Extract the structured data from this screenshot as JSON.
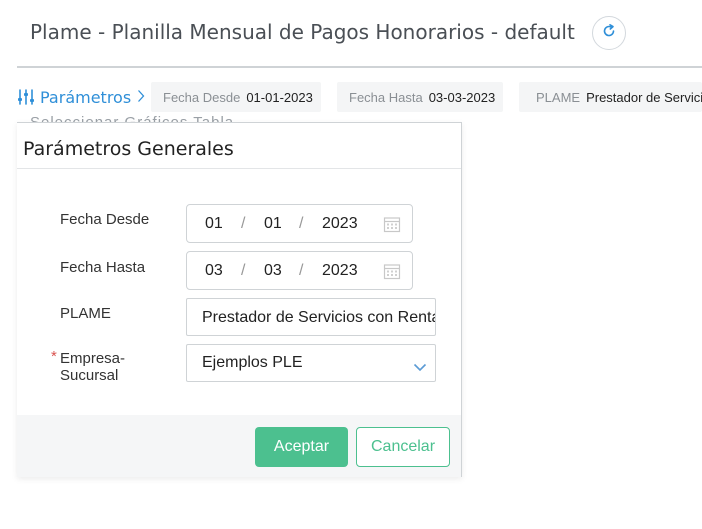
{
  "header": {
    "title": "Plame - Planilla Mensual de Pagos Honorarios - default",
    "refresh_icon": "refresh-icon"
  },
  "filter_bar": {
    "params_label": "Parámetros",
    "chips": [
      {
        "label": "Fecha Desde",
        "value": "01-01-2023"
      },
      {
        "label": "Fecha Hasta",
        "value": "03-03-2023"
      },
      {
        "label": "PLAME",
        "value": "Prestador de Servicios con Rentas de Cuarta"
      }
    ],
    "hidden_tabs_text": "Seleccionar    Gráficos    Tabla"
  },
  "popup": {
    "title": "Parámetros Generales",
    "fields": {
      "fecha_desde": {
        "label": "Fecha Desde",
        "day": "01",
        "month": "01",
        "year": "2023",
        "sep": "/"
      },
      "fecha_hasta": {
        "label": "Fecha Hasta",
        "day": "03",
        "month": "03",
        "year": "2023",
        "sep": "/"
      },
      "plame": {
        "label": "PLAME",
        "value": "Prestador de Servicios con Rentas de Cuarta"
      },
      "empresa": {
        "label_line1": "Empresa-",
        "label_line2": "Sucursal",
        "required_mark": "*",
        "value": "Ejemplos PLE"
      }
    },
    "buttons": {
      "accept": "Aceptar",
      "cancel": "Cancelar"
    }
  },
  "colors": {
    "accent_blue": "#2f8fd8",
    "accent_green": "#4cc08f",
    "required_red": "#d9534f"
  }
}
